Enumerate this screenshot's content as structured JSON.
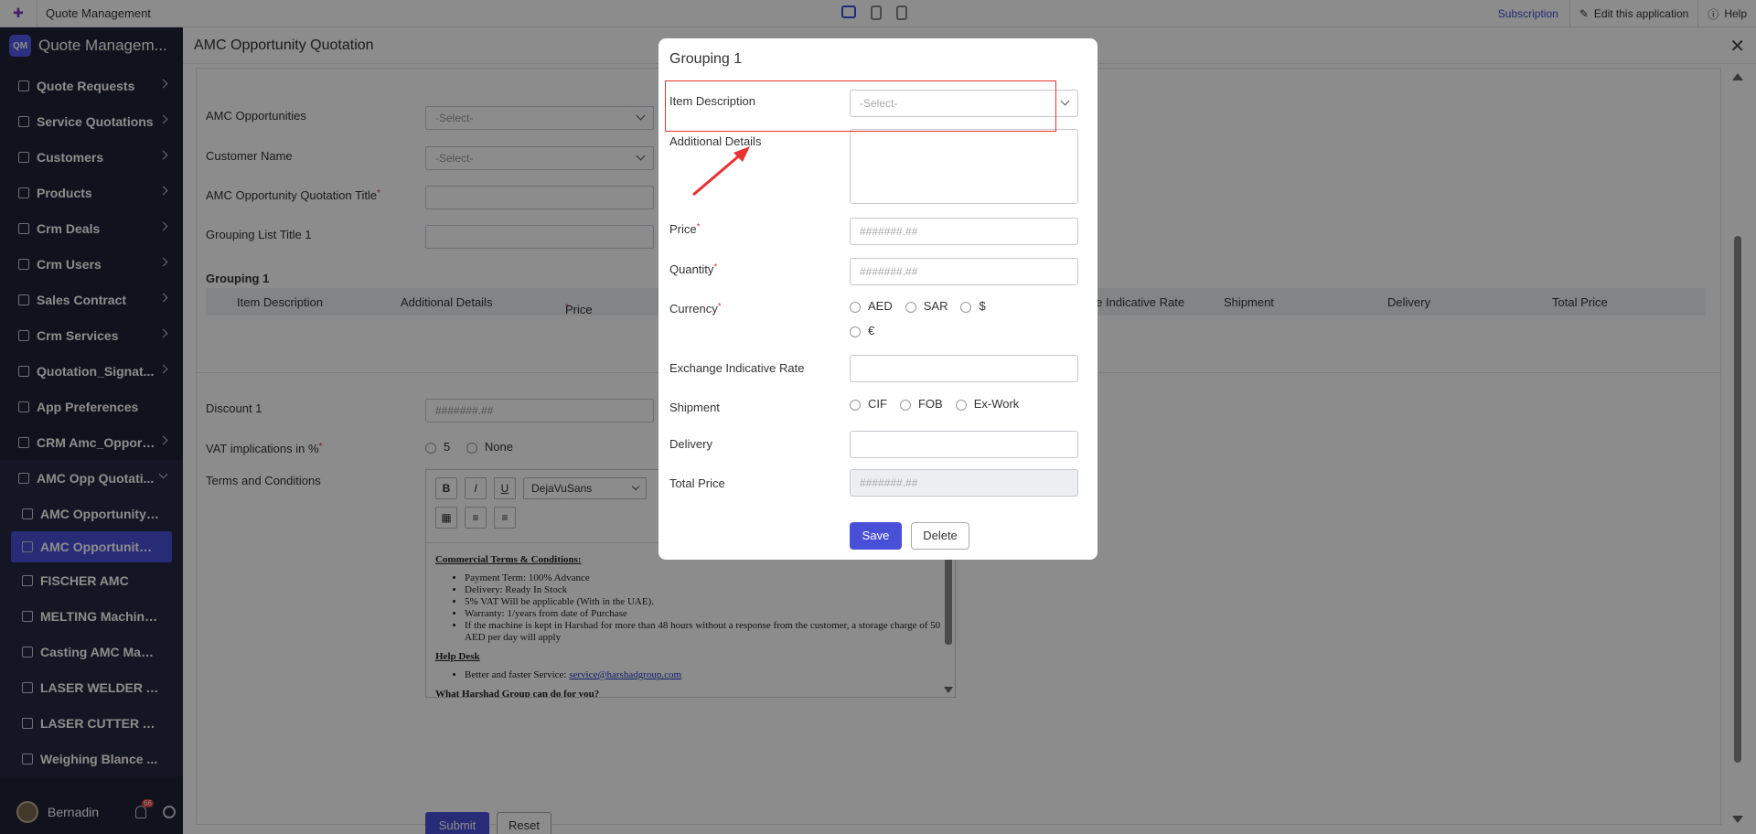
{
  "topbar": {
    "app_name": "Quote Management",
    "subscription": "Subscription",
    "edit_app": "Edit this application",
    "help": "Help"
  },
  "sidebar": {
    "logo_text": "QM",
    "title": "Quote Managem...",
    "items": [
      {
        "label": "Quote Requests"
      },
      {
        "label": "Service Quotations"
      },
      {
        "label": "Customers"
      },
      {
        "label": "Products"
      },
      {
        "label": "Crm Deals"
      },
      {
        "label": "Crm Users"
      },
      {
        "label": "Sales Contract"
      },
      {
        "label": "Crm Services"
      },
      {
        "label": "Quotation_Signat..."
      },
      {
        "label": "App Preferences"
      },
      {
        "label": "CRM Amc_Opport..."
      },
      {
        "label": "AMC Opp Quotati..."
      }
    ],
    "sub_items": [
      {
        "label": "AMC Opportunity ..."
      },
      {
        "label": "AMC Opportunity ..."
      },
      {
        "label": "FISCHER AMC"
      },
      {
        "label": "MELTING Machine..."
      },
      {
        "label": "Casting AMC Mach..."
      },
      {
        "label": "LASER WELDER A..."
      },
      {
        "label": "LASER CUTTER AMC"
      },
      {
        "label": "Weighing Blance ..."
      }
    ],
    "user": "Bernadin",
    "notif_count": "66"
  },
  "page": {
    "title": "AMC Opportunity Quotation",
    "fields": {
      "amc_opportunities": "AMC Opportunities",
      "customer_name": "Customer Name",
      "quotation_title": "AMC Opportunity Quotation Title",
      "grouping_list_title": "Grouping List Title 1",
      "select_placeholder": "-Select-"
    },
    "grouping_title": "Grouping 1",
    "grid_columns": [
      "Item Description",
      "Additional Details",
      "Price",
      "ge Indicative Rate",
      "Shipment",
      "Delivery",
      "Total Price"
    ],
    "discount_label": "Discount 1",
    "number_placeholder": "#######.##",
    "vat_label": "VAT implications in %",
    "vat_options": [
      "5",
      "None"
    ],
    "terms_label": "Terms and Conditions",
    "editor": {
      "bold": "B",
      "italic": "I",
      "underline": "U",
      "font": "DejaVuSans",
      "heading1": "Commercial Terms & Conditions:",
      "bullets1": [
        "Payment Term: 100% Advance",
        "Delivery: Ready In Stock",
        "5% VAT Will be applicable (With in the UAE).",
        "Warranty: 1/years from date of Purchase",
        "If the machine is kept in Harshad for more than 48 hours without a response from the customer, a storage charge of 50 AED per day will apply"
      ],
      "heading2": "Help Desk",
      "service_prefix": "Better and faster Service: ",
      "service_email": "service@harshadgroup.com",
      "heading3": "What Harshad Group can do for you?"
    },
    "submit": "Submit",
    "reset": "Reset"
  },
  "modal": {
    "title": "Grouping 1",
    "item_description": "Item Description",
    "select_placeholder": "-Select-",
    "additional_details": "Additional Details",
    "price": "Price",
    "quantity": "Quantity",
    "number_placeholder": "#######.##",
    "currency": "Currency",
    "currency_options": [
      "AED",
      "SAR",
      "$",
      "€"
    ],
    "exchange_rate": "Exchange Indicative Rate",
    "shipment": "Shipment",
    "shipment_options": [
      "CIF",
      "FOB",
      "Ex-Work"
    ],
    "delivery": "Delivery",
    "total_price": "Total Price",
    "save": "Save",
    "delete": "Delete"
  },
  "colors": {
    "accent": "#4a4fd8",
    "sidebar_bg": "#1e2235",
    "highlight": "#e83131"
  }
}
